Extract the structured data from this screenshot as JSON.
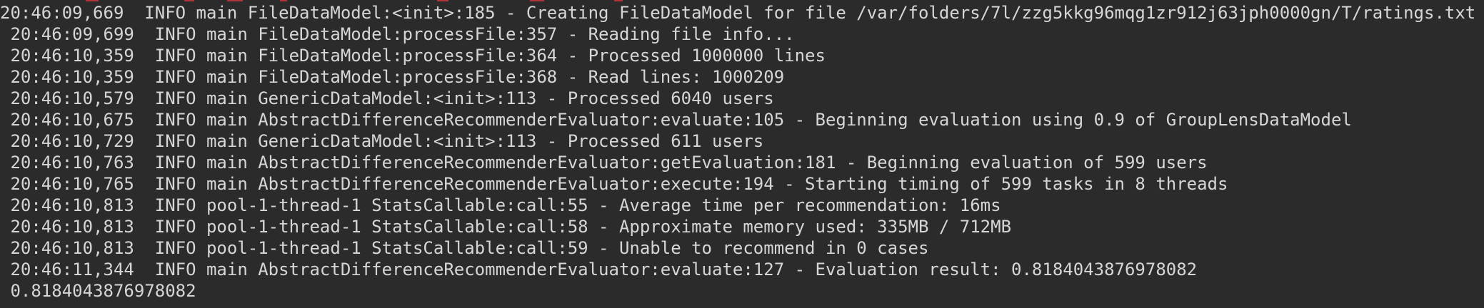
{
  "terminal": {
    "lines": [
      "20:46:09,669  INFO main FileDataModel:<init>:185 - Creating FileDataModel for file /var/folders/7l/zzg5kkg96mqg1zr912j63jph0000gn/T/ratings.txt",
      " 20:46:09,699  INFO main FileDataModel:processFile:357 - Reading file info...",
      " 20:46:10,359  INFO main FileDataModel:processFile:364 - Processed 1000000 lines",
      " 20:46:10,359  INFO main FileDataModel:processFile:368 - Read lines: 1000209",
      " 20:46:10,579  INFO main GenericDataModel:<init>:113 - Processed 6040 users",
      " 20:46:10,675  INFO main AbstractDifferenceRecommenderEvaluator:evaluate:105 - Beginning evaluation using 0.9 of GroupLensDataModel",
      " 20:46:10,729  INFO main GenericDataModel:<init>:113 - Processed 611 users",
      " 20:46:10,763  INFO main AbstractDifferenceRecommenderEvaluator:getEvaluation:181 - Beginning evaluation of 599 users",
      " 20:46:10,765  INFO main AbstractDifferenceRecommenderEvaluator:execute:194 - Starting timing of 599 tasks in 8 threads",
      " 20:46:10,813  INFO pool-1-thread-1 StatsCallable:call:55 - Average time per recommendation: 16ms",
      " 20:46:10,813  INFO pool-1-thread-1 StatsCallable:call:58 - Approximate memory used: 335MB / 712MB",
      " 20:46:10,813  INFO pool-1-thread-1 StatsCallable:call:59 - Unable to recommend in 0 cases",
      " 20:46:11,344  INFO main AbstractDifferenceRecommenderEvaluator:evaluate:127 - Evaluation result: 0.8184043876978082",
      " 0.8184043876978082"
    ]
  },
  "colors": {
    "background": "#2b2b2b",
    "text": "#d6d6d6",
    "top_strip_accent": "#b0343c"
  }
}
